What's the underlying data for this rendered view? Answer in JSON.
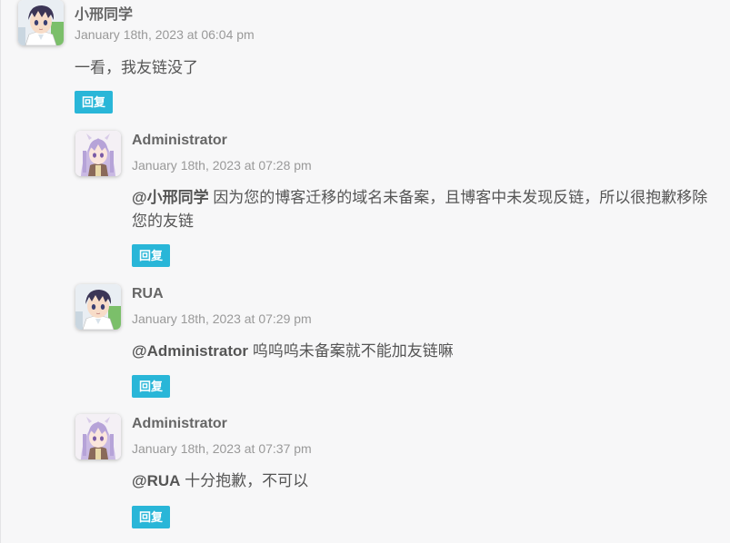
{
  "colors": {
    "background": "#f7f7f8",
    "reply_button": "#29b6d8",
    "author_text": "#666666",
    "date_text": "#999999"
  },
  "comments": [
    {
      "author": "小邢同学",
      "date": "January 18th, 2023 at 06:04 pm",
      "mention": "",
      "text": "一看，我友链没了",
      "reply_label": "回复",
      "avatar": "boy-anime-avatar"
    },
    {
      "author": "Administrator",
      "date": "January 18th, 2023 at 07:28 pm",
      "mention": "@小邢同学",
      "text": "因为您的博客迁移的域名未备案，且博客中未发现反链，所以很抱歉移除您的友链",
      "reply_label": "回复",
      "avatar": "girl-anime-avatar"
    },
    {
      "author": "RUA",
      "date": "January 18th, 2023 at 07:29 pm",
      "mention": "@Administrator",
      "text": "呜呜呜未备案就不能加友链嘛",
      "reply_label": "回复",
      "avatar": "boy-anime-avatar"
    },
    {
      "author": "Administrator",
      "date": "January 18th, 2023 at 07:37 pm",
      "mention": "@RUA",
      "text": "十分抱歉，不可以",
      "reply_label": "回复",
      "avatar": "girl-anime-avatar"
    }
  ]
}
